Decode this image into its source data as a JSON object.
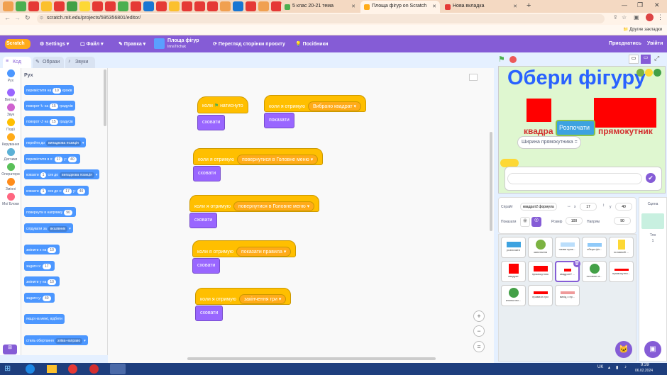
{
  "browser": {
    "tabs": [
      {
        "title": "5 клас 20-21 тема"
      },
      {
        "title": "Площа фігур on Scratch"
      },
      {
        "title": "Нова вкладка"
      }
    ],
    "url": "scratch.mit.edu/projects/595356801/editor/",
    "bookmarks_label": "Другие закладки"
  },
  "menu": {
    "logo": "Scratch",
    "settings": "Settings",
    "file": "Файл",
    "edit": "Правка",
    "project_title": "Площа фігур",
    "author": "InnaTrichuk",
    "see_project": "Перегляд сторінки проєкту",
    "tutorials": "Посібники",
    "share": "Приєднатись",
    "signin": "Увійти"
  },
  "editor_tabs": [
    "Код",
    "Образи",
    "Звуки"
  ],
  "categories": [
    {
      "label": "Рух",
      "color": "#4c97ff"
    },
    {
      "label": "Вигляд",
      "color": "#9966ff"
    },
    {
      "label": "Звук",
      "color": "#cf63cf"
    },
    {
      "label": "Події",
      "color": "#ffbf00"
    },
    {
      "label": "Керування",
      "color": "#ffab19"
    },
    {
      "label": "Датчики",
      "color": "#5cb1d6"
    },
    {
      "label": "Оператори",
      "color": "#59c059"
    },
    {
      "label": "Змінні",
      "color": "#ff8c1a"
    },
    {
      "label": "Мої Блоки",
      "color": "#ff6680"
    }
  ],
  "palette": {
    "heading": "Рух",
    "blocks": [
      {
        "text": "перемістити на",
        "arg": "10",
        "tail": "кроків"
      },
      {
        "text": "поворот ↻ на",
        "arg": "15",
        "tail": "градусів"
      },
      {
        "text": "поворот ↺ на",
        "arg": "15",
        "tail": "градусів"
      },
      {
        "text": "перейти до",
        "dd": "випадкова позиція"
      },
      {
        "text": "перемістити в x:",
        "arg": "17",
        "tail": "y:",
        "arg2": "40"
      },
      {
        "text": "ковзати",
        "arg": "1",
        "tail": "сек до",
        "dd": "випадкова позиція"
      },
      {
        "text": "ковзати",
        "arg": "1",
        "tail": "сек до x:",
        "arg2": "17",
        "tail2": "y:",
        "arg3": "40"
      },
      {
        "text": "повернути в напрямку",
        "arg": "90"
      },
      {
        "text": "слідувати за",
        "dd": "вказівник"
      },
      {
        "text": "змінити x на",
        "arg": "10"
      },
      {
        "text": "задати x:",
        "arg": "17"
      },
      {
        "text": "змінити y на",
        "arg": "10"
      },
      {
        "text": "задати y:",
        "arg": "40"
      },
      {
        "text": "якщо на межі, відбити"
      },
      {
        "text": "стиль обертання",
        "dd": "зліва-направо"
      }
    ]
  },
  "scripts": [
    {
      "hat": "коли",
      "flag": true,
      "hat_tail": "натиснуто",
      "body": "сховати"
    },
    {
      "hat": "коли я отримую",
      "dd": "Вибрано квадрат",
      "body": "показати"
    },
    {
      "hat": "коли я отримую",
      "dd": "повернутися в Головне меню",
      "body": "сховати"
    },
    {
      "hat": "коли я отримую",
      "dd": "повернутися в Головне меню",
      "body": "сховати"
    },
    {
      "hat": "коли я отримую",
      "dd": "показати правила",
      "body": "сховати"
    },
    {
      "hat": "коли я отримую",
      "dd": "закінчення гри",
      "body": "сховати"
    }
  ],
  "stage": {
    "title": "Обери фігуру",
    "start_button": "Розпочати",
    "left_label": "квадра",
    "right_label": "прямокутник",
    "question": "Ширина прямокутника ="
  },
  "sprite_info": {
    "sprite_label": "Спрайт",
    "sprite_name": "квадрат2 формула",
    "x_label": "x",
    "x": "17",
    "y_label": "y",
    "y": "40",
    "show_label": "Показати",
    "size_label": "Розмір",
    "size": "100",
    "direction_label": "Напрям",
    "direction": "90"
  },
  "sprites": [
    {
      "name": "розпочати"
    },
    {
      "name": "запитання"
    },
    {
      "name": "назва проє..."
    },
    {
      "name": "обери фіг..."
    },
    {
      "name": "головний ..."
    },
    {
      "name": "квадрат"
    },
    {
      "name": "прямокутник"
    },
    {
      "name": "квадрат2 ..."
    },
    {
      "name": "головне м..."
    },
    {
      "name": "прямокутни..."
    },
    {
      "name": "кнопка ви..."
    },
    {
      "name": "правила гри"
    },
    {
      "name": "вихід з пр..."
    }
  ],
  "stage_panel": {
    "title": "Сцена",
    "backdrops_label": "Тло",
    "backdrops": "1"
  },
  "taskbar": {
    "lang": "UK",
    "time": "9:39",
    "date": "06.02.2024"
  }
}
